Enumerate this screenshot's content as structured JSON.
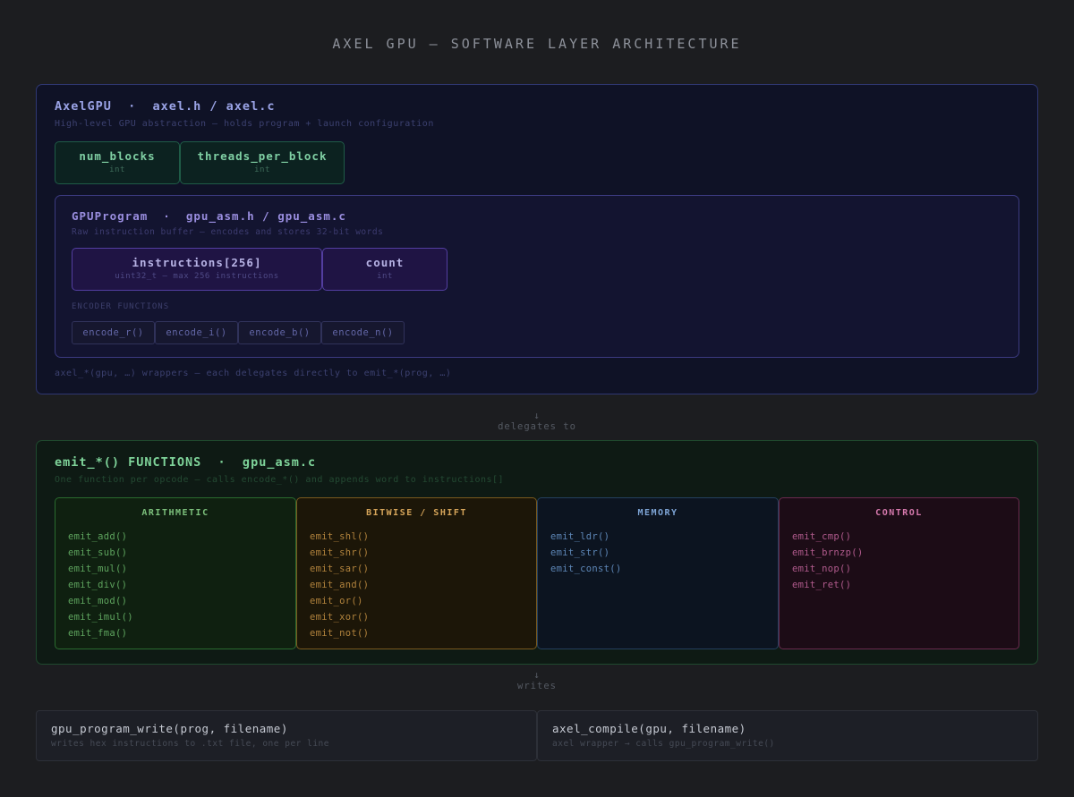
{
  "title": "AXEL GPU — SOFTWARE LAYER ARCHITECTURE",
  "axelgpu": {
    "title": "AxelGPU  ·  axel.h / axel.c",
    "subtitle": "High-level GPU abstraction — holds program + launch configuration",
    "fields": [
      {
        "name": "num_blocks",
        "type": "int"
      },
      {
        "name": "threads_per_block",
        "type": "int"
      }
    ],
    "footer": "axel_*(gpu, …) wrappers — each delegates directly to emit_*(prog, …)"
  },
  "gpuprogram": {
    "title": "GPUProgram  ·  gpu_asm.h / gpu_asm.c",
    "subtitle": "Raw instruction buffer — encodes and stores 32-bit words",
    "fields": [
      {
        "name": "instructions[256]",
        "type": "uint32_t — max 256 instructions"
      },
      {
        "name": "count",
        "type": "int"
      }
    ],
    "encoder_label": "ENCODER FUNCTIONS",
    "encoders": [
      "encode_r()",
      "encode_i()",
      "encode_b()",
      "encode_n()"
    ]
  },
  "connector1": {
    "arrow": "↓",
    "label": "delegates to"
  },
  "emit": {
    "title": "emit_*() FUNCTIONS  ·  gpu_asm.c",
    "subtitle": "One function per opcode — calls encode_*() and appends word to instructions[]",
    "columns": [
      {
        "heading": "ARITHMETIC",
        "items": [
          "emit_add()",
          "emit_sub()",
          "emit_mul()",
          "emit_div()",
          "emit_mod()",
          "emit_imul()",
          "emit_fma()"
        ]
      },
      {
        "heading": "BITWISE / SHIFT",
        "items": [
          "emit_shl()",
          "emit_shr()",
          "emit_sar()",
          "emit_and()",
          "emit_or()",
          "emit_xor()",
          "emit_not()"
        ]
      },
      {
        "heading": "MEMORY",
        "items": [
          "emit_ldr()",
          "emit_str()",
          "emit_const()"
        ]
      },
      {
        "heading": "CONTROL",
        "items": [
          "emit_cmp()",
          "emit_brnzp()",
          "emit_nop()",
          "emit_ret()"
        ]
      }
    ]
  },
  "connector2": {
    "arrow": "↓",
    "label": "writes"
  },
  "outputs": [
    {
      "name": "gpu_program_write(prog, filename)",
      "desc": "writes hex instructions to .txt file, one per line"
    },
    {
      "name": "axel_compile(gpu, filename)",
      "desc": "axel wrapper → calls gpu_program_write()"
    }
  ],
  "colors": {
    "background": "#1c1d20",
    "axelgpu_border": "#2f3772",
    "gpuprogram_border": "#3b3a80",
    "emit_border": "#1f4a2e",
    "arithmetic": "#7cc07c",
    "bitwise": "#d6a55a",
    "memory": "#7ea5d6",
    "control": "#d679ad"
  }
}
